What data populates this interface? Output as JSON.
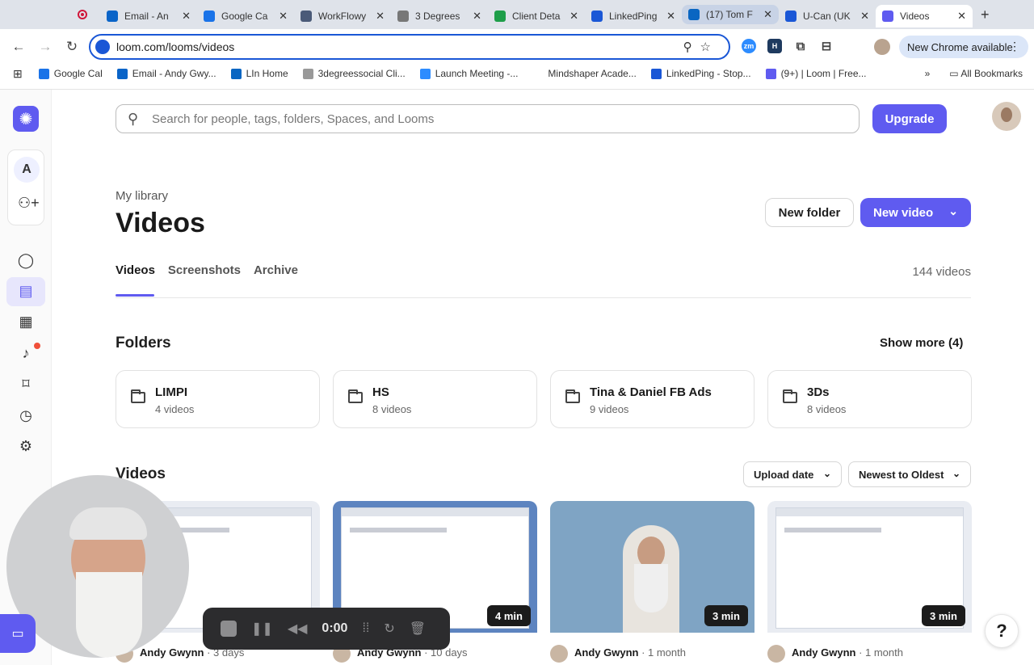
{
  "browser": {
    "tabs": [
      {
        "title": "Email - An",
        "icon": "outlook-icon",
        "color": "#0a64c8"
      },
      {
        "title": "Google Ca",
        "icon": "calendar-icon",
        "color": "#1a73e8"
      },
      {
        "title": "WorkFlowy",
        "icon": "doc-icon",
        "color": "#4a5a78"
      },
      {
        "title": "3 Degrees",
        "icon": "loading-icon",
        "color": "#777777"
      },
      {
        "title": "Client Deta",
        "icon": "sheets-icon",
        "color": "#1e9e49"
      },
      {
        "title": "LinkedPing",
        "icon": "doc-icon",
        "color": "#1a57d6"
      },
      {
        "title": "(17) Tom F",
        "icon": "linkedin-icon",
        "color": "#0a66c2"
      },
      {
        "title": "U-Can (UK",
        "icon": "doc-icon",
        "color": "#1a57d6"
      },
      {
        "title": "Videos",
        "icon": "loom-icon",
        "color": "#5f5bf0"
      }
    ],
    "url": "loom.com/looms/videos",
    "new_chrome_label": "New Chrome available",
    "bookmarks": [
      {
        "label": "Google Cal",
        "color": "#1a73e8"
      },
      {
        "label": "Email - Andy Gwy...",
        "color": "#0a64c8"
      },
      {
        "label": "LIn Home",
        "color": "#0a66c2"
      },
      {
        "label": "3degreessocial Cli...",
        "color": "#999999"
      },
      {
        "label": "Launch Meeting -...",
        "color": "#2d8cff"
      },
      {
        "label": "Mindshaper Acade...",
        "color": "#ffffff"
      },
      {
        "label": "LinkedPing - Stop...",
        "color": "#1a57d6"
      },
      {
        "label": "(9+) | Loom | Free...",
        "color": "#5f5bf0"
      }
    ],
    "all_bookmarks_label": "All Bookmarks"
  },
  "sidebar": {
    "workspace_initial": "A"
  },
  "header": {
    "search_placeholder": "Search for people, tags, folders, Spaces, and Looms",
    "upgrade_label": "Upgrade"
  },
  "page": {
    "breadcrumb": "My library",
    "title": "Videos",
    "new_folder_label": "New folder",
    "new_video_label": "New video",
    "tabs": [
      "Videos",
      "Screenshots",
      "Archive"
    ],
    "video_count": "144 videos"
  },
  "folders": {
    "heading": "Folders",
    "show_more": "Show more (4)",
    "items": [
      {
        "name": "LIMPI",
        "count": "4 videos"
      },
      {
        "name": "HS",
        "count": "8 videos"
      },
      {
        "name": "Tina & Daniel FB Ads",
        "count": "9 videos"
      },
      {
        "name": "3Ds",
        "count": "8 videos"
      }
    ]
  },
  "videos": {
    "heading": "Videos",
    "sort_field": "Upload date",
    "sort_order": "Newest to Oldest",
    "items": [
      {
        "author": "Andy Gwynn",
        "age": "3 days",
        "duration": ""
      },
      {
        "author": "Andy Gwynn",
        "age": "10 days",
        "duration": "4 min"
      },
      {
        "author": "Andy Gwynn",
        "age": "1 month",
        "duration": "3 min"
      },
      {
        "author": "Andy Gwynn",
        "age": "1 month",
        "duration": "3 min"
      }
    ]
  },
  "recorder": {
    "time": "0:00"
  },
  "help_label": "?"
}
